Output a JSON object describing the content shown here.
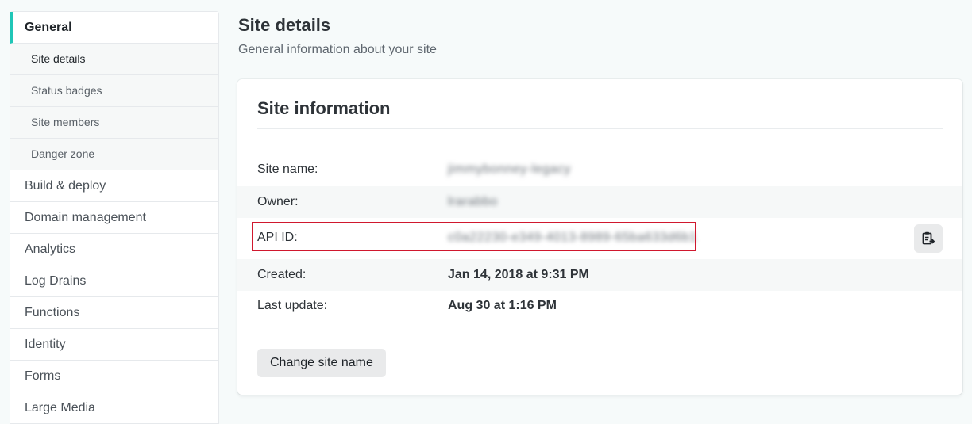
{
  "sidebar": {
    "items": [
      {
        "label": "General",
        "active": true
      },
      {
        "label": "Build & deploy"
      },
      {
        "label": "Domain management"
      },
      {
        "label": "Analytics"
      },
      {
        "label": "Log Drains"
      },
      {
        "label": "Functions"
      },
      {
        "label": "Identity"
      },
      {
        "label": "Forms"
      },
      {
        "label": "Large Media"
      }
    ],
    "subitems": [
      {
        "label": "Site details",
        "selected": true
      },
      {
        "label": "Status badges"
      },
      {
        "label": "Site members"
      },
      {
        "label": "Danger zone"
      }
    ]
  },
  "page": {
    "title": "Site details",
    "subtitle": "General information about your site"
  },
  "card": {
    "title": "Site information",
    "rows": [
      {
        "label": "Site name:",
        "value": "jimmybonney-legacy",
        "blurred": true
      },
      {
        "label": "Owner:",
        "value": "lrarabbo",
        "blurred": true
      },
      {
        "label": "API ID:",
        "value": "c0a22230-e349-4013-8989-65ba633d6b1",
        "blurred": true
      },
      {
        "label": "Created:",
        "value": "Jan 14, 2018 at 9:31 PM"
      },
      {
        "label": "Last update:",
        "value": "Aug 30 at 1:16 PM"
      }
    ],
    "copy_icon": "clipboard-copy-icon",
    "change_button": "Change site name"
  },
  "colors": {
    "accent": "#20c6b7",
    "highlight": "#d0182e"
  }
}
